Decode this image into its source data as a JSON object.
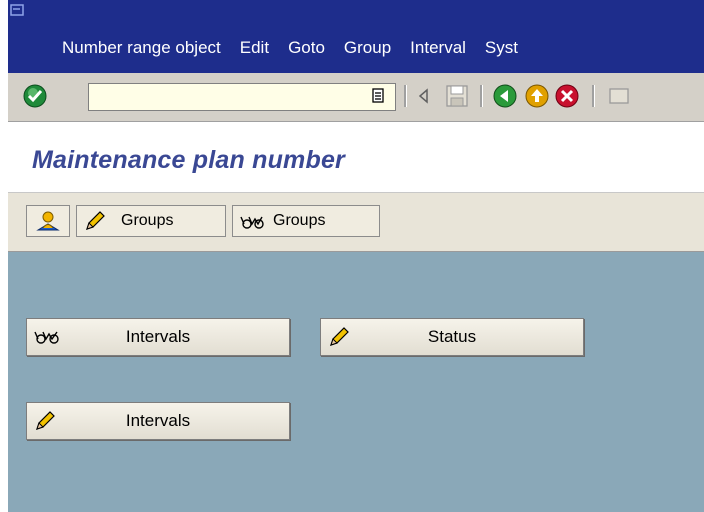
{
  "menubar": {
    "items": [
      {
        "label": "Number range object"
      },
      {
        "label": "Edit"
      },
      {
        "label": "Goto"
      },
      {
        "label": "Group"
      },
      {
        "label": "Interval"
      },
      {
        "label": "Syst"
      }
    ]
  },
  "toolbar": {
    "command_field_value": "",
    "icons": [
      "enter-check-icon",
      "command-history-icon",
      "back-arrow-icon",
      "save-icon",
      "back-icon",
      "exit-icon",
      "cancel-icon"
    ]
  },
  "title": {
    "text": "Maintenance plan number"
  },
  "apptoolbar": {
    "buttons": [
      {
        "label": "",
        "icon": "user-icon"
      },
      {
        "label": "Groups",
        "icon": "pencil-icon"
      },
      {
        "label": "Groups",
        "icon": "glasses-icon"
      }
    ]
  },
  "main": {
    "buttons": [
      {
        "label": "Intervals",
        "icon": "glasses-icon"
      },
      {
        "label": "Status",
        "icon": "pencil-icon"
      },
      {
        "label": "Intervals",
        "icon": "pencil-icon"
      }
    ]
  },
  "colors": {
    "menubar": "#1e2d8c",
    "title": "#3a4894",
    "main_bg": "#8aa8b8"
  }
}
